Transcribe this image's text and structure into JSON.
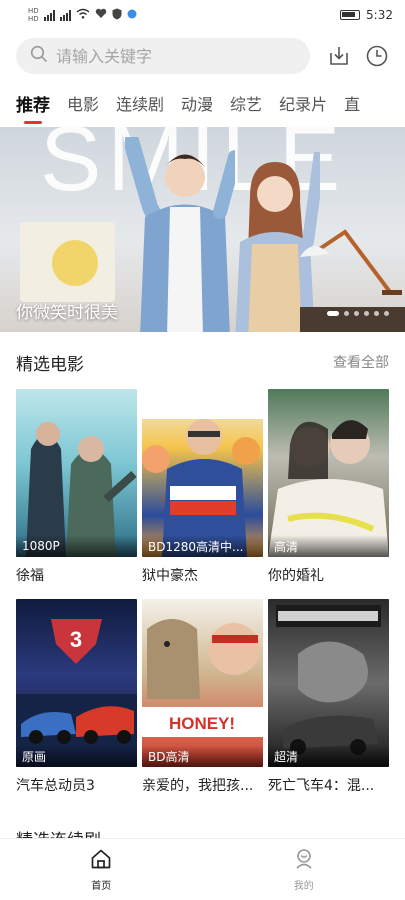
{
  "status_bar": {
    "time": "5:32",
    "sim_tags": [
      "HD",
      "HD"
    ]
  },
  "search": {
    "placeholder": "请输入关键字"
  },
  "tabs": [
    {
      "label": "推荐",
      "active": true
    },
    {
      "label": "电影"
    },
    {
      "label": "连续剧"
    },
    {
      "label": "动漫"
    },
    {
      "label": "综艺"
    },
    {
      "label": "纪录片"
    },
    {
      "label": "直"
    }
  ],
  "banner": {
    "caption": "你微笑时很美",
    "background_text": "SMILE",
    "slide_count": 6,
    "active_slide": 1
  },
  "featured_movies": {
    "title": "精选电影",
    "more_label": "查看全部",
    "items": [
      {
        "title": "徐福",
        "tag": "1080P"
      },
      {
        "title": "狱中豪杰",
        "tag": "BD1280高清中..."
      },
      {
        "title": "你的婚礼",
        "tag": "高清"
      },
      {
        "title": "汽车总动员3",
        "tag": "原画"
      },
      {
        "title": "亲爱的，我把孩...",
        "tag": "BD高清"
      },
      {
        "title": "死亡飞车4：混...",
        "tag": "超清"
      }
    ]
  },
  "next_section": {
    "title": "精选连续剧"
  },
  "bottom_nav": {
    "home_label": "首页",
    "mine_label": "我的"
  },
  "colors": {
    "accent": "#e8303d",
    "search_bg": "#f0f0f0",
    "text_primary": "#222222",
    "text_secondary": "#888888"
  }
}
